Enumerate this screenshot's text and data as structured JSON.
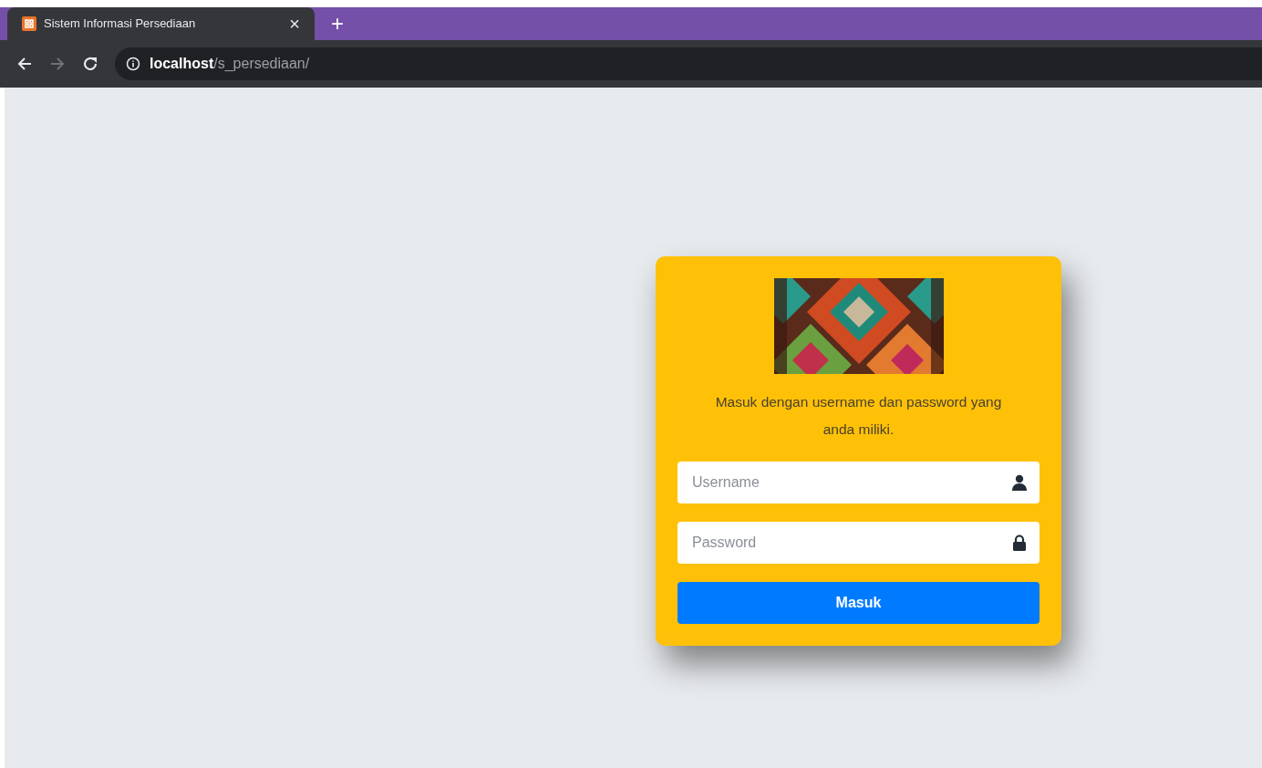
{
  "browser": {
    "tab": {
      "title": "Sistem Informasi Persediaan",
      "close": "×"
    },
    "new_tab": "+",
    "forward_enabled": false,
    "address": "**localhost**/s_persediaan/"
  },
  "login": {
    "message": "Masuk dengan username dan password yang anda miliki.",
    "fields": [
      {
        "kind": "user",
        "placeholder": "Username"
      },
      {
        "kind": "lock",
        "placeholder": "Password"
      }
    ],
    "button": "Masuk"
  }
}
